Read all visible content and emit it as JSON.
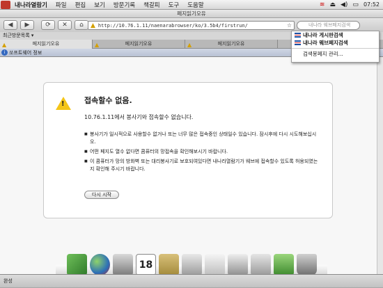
{
  "menubar": {
    "items": [
      "내나라열람기",
      "파일",
      "편집",
      "보기",
      "방문기록",
      "책갈피",
      "도구",
      "도움말"
    ],
    "clock": "07:52"
  },
  "window": {
    "title": "페지읽기오유"
  },
  "toolbar": {
    "back_label": "◀",
    "forward_label": "▶",
    "reload_label": "⟳",
    "stop_label": "✕",
    "home_label": "⌂",
    "url": "http://10.76.1.11/naenarabrowser/ko/3.5b4/firstrun/",
    "search_placeholder": "내나라 웨브페지검색"
  },
  "bookmarks": {
    "label": "최근방문목록 ▾"
  },
  "tabs": [
    {
      "label": "페지읽기오유",
      "active": true
    },
    {
      "label": "페지읽기오유",
      "active": false
    },
    {
      "label": "페지읽기오유",
      "active": false
    }
  ],
  "infobar": {
    "text": "쏘프트웨어 정보"
  },
  "error": {
    "title": "접속할수 없음.",
    "description": "10.76.1.11에서 봉사기와 접속할수 없습니다.",
    "items": [
      "봉사기가 일시적으로 사용할수 없거나 또는 너무 많은 접속중인 상태일수 있습니다. 잠시후에 다시 시도해보십시오.",
      "어떤 페지도 열수 없다면 콤퓨터의 망접속을 확인해보시기 바랍니다.",
      "이 콤퓨터가 망의 방화벽 또는 대리봉사기로 보호되여있다면 내나라열람기가 웨브에 접속할수 있도록 허용되였는지 확인해 주시기 바랍니다."
    ],
    "retry_label": "다시 시작"
  },
  "search_popup": {
    "items": [
      {
        "label": "내나라 게시판검색",
        "icon": "flag-icon"
      },
      {
        "label": "내나라 웨브페지검색",
        "icon": "flag-icon"
      }
    ],
    "manage_label": "검색봉페지 관리..."
  },
  "dock": {
    "icons": [
      "document-icon",
      "globe-icon",
      "video-icon",
      "calendar-icon",
      "address-book-icon",
      "photo-icon",
      "drawing-icon",
      "calculator-icon",
      "tools-icon",
      "folder-icon",
      "trash-icon"
    ]
  },
  "statusbar": {
    "text": "완성"
  }
}
